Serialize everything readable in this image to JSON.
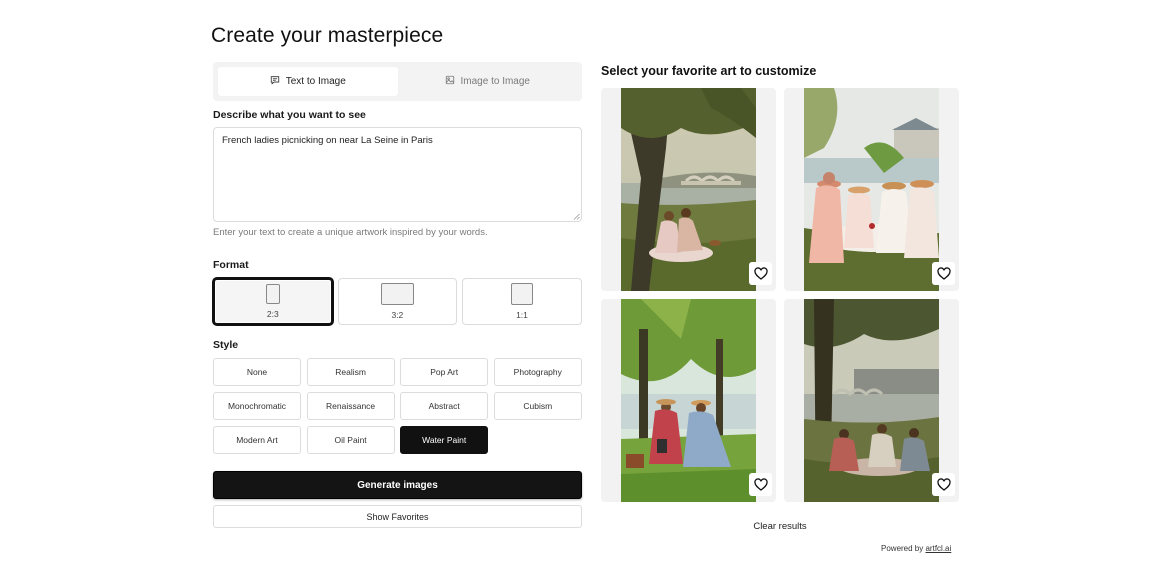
{
  "page": {
    "title": "Create your masterpiece"
  },
  "mode_tabs": [
    {
      "label": "Text to Image",
      "icon": "chat-bubble-icon",
      "active": true
    },
    {
      "label": "Image to Image",
      "icon": "image-icon",
      "active": false
    }
  ],
  "prompt": {
    "label": "Describe what you want to see",
    "value": "French ladies picnicking on near La Seine in Paris",
    "hint": "Enter your text to create a unique artwork inspired by your words."
  },
  "format": {
    "label": "Format",
    "options": [
      {
        "label": "2:3",
        "selected": true
      },
      {
        "label": "3:2",
        "selected": false
      },
      {
        "label": "1:1",
        "selected": false
      }
    ]
  },
  "style": {
    "label": "Style",
    "options": [
      "None",
      "Realism",
      "Pop Art",
      "Photography",
      "Monochromatic",
      "Renaissance",
      "Abstract",
      "Cubism",
      "Modern Art",
      "Oil Paint",
      "Water Paint"
    ],
    "selected": "Water Paint"
  },
  "actions": {
    "generate": "Generate images",
    "show_favorites": "Show Favorites"
  },
  "gallery": {
    "title": "Select your favorite art to customize",
    "clear": "Clear results",
    "icon": "heart-icon"
  },
  "footer": {
    "powered_prefix": "Powered by",
    "powered_link": "artfcl.ai"
  },
  "colors": {
    "accent": "#141414",
    "panel_bg": "#f3f3f3",
    "border": "#dcdcdc"
  }
}
